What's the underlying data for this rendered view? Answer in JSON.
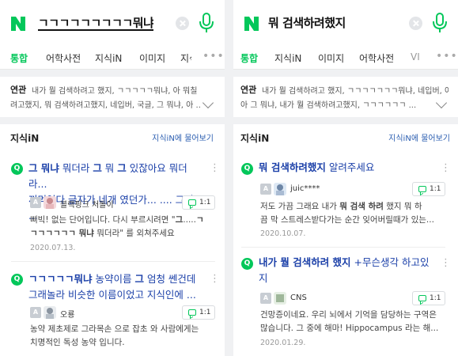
{
  "left": {
    "query": "ㄱㄱㄱㄱㄱㄱㄱㄱㄱ뭐냐",
    "tabs": [
      "통합",
      "어학사전",
      "지식iN",
      "이미지",
      "지식"
    ],
    "related_label": "연관",
    "related_lines": [
      "내가 뭘 검색하려고 했지, ㄱㄱㄱㄱㄱ뭐냐, 아 뭐칠",
      "려고했지, 뭐 검색하려고했지, 네입버, 국글, 그 뭐냐, 아 ..."
    ],
    "kin_title": "지식iN",
    "kin_link": "지식iN에 물어보기",
    "results": [
      {
        "title_lines": [
          "<b>그 뭐냐</b> 뭐더라 <b>그</b> 뭐 <b>그</b> 있잖아요 뭐더라...",
          "꺼먹었다 글자가 네개 였던가... .... 그거 ..."
        ],
        "author": "블랙핑크 처돌이",
        "reply": "1:1",
        "snippet": [
          "삐빅! 없는 단어입니다. 다시 부르시려면 \"<b>그</b>.....<b>ㄱ</b>",
          "<b>ㄱㄱㄱㄱㄱㄱ 뭐냐</b> 뭐더라\" 를 외쳐주세요"
        ],
        "date": "2020.07.13."
      },
      {
        "title_lines": [
          "<b>ㄱㄱㄱㄱㄱ뭐냐</b> 농약이름 <b>그</b> 엄청 쎈건데",
          "그래놀라 비슷한 이름이었고 지식인에 ..."
        ],
        "author": "오룡",
        "reply": "1:1",
        "snippet": [
          "농약 제초제로 그라목손 으로 잡초 와 사람에게는",
          "치명적인 독성 농약 입니다."
        ],
        "date": ""
      }
    ]
  },
  "right": {
    "query": "뭐 검색하려했지",
    "tabs": [
      "통합",
      "지식iN",
      "이미지",
      "어학사전",
      "VI"
    ],
    "related_label": "연관",
    "related_lines": [
      "내가 뭘 검색하려고 했지, ㄱㄱㄱㄱㄱㄱㄱ뭐냐, 네입버, 아 뭐",
      "아 그 뭐냐, 내가 뭘 검색하려고했지, ㄱㄱㄱㄱㄱㄱ ..."
    ],
    "kin_title": "지식iN",
    "kin_link": "지식iN에 물어보기",
    "results": [
      {
        "title_lines": [
          "<b>뭐 검색하려했지</b> 알려주세요"
        ],
        "author": "juic****",
        "reply": "1:1",
        "snippet": [
          "저도 가끔 그래요 내가 <b>뭐 검색 하려</b> 했지 뭐 하",
          "끔 막 스트레스받다가는 순간 잊어버릴때가 있는..."
        ],
        "date": "2020.10.07."
      },
      {
        "title_lines": [
          "<b>내가 뭘 검색하려 했지</b> +무슨생각 하고있",
          "지"
        ],
        "author": "CNS",
        "reply": "1:1",
        "snippet": [
          "건망증이네요. 우리 뇌에서 기억을 담당하는 구역은",
          "많습니다. 그 중에 해마! Hippocampus 라는 해..."
        ],
        "date": "2020.01.29."
      }
    ]
  },
  "colors": {
    "brand": "#03c75a",
    "link": "#1a3fa8",
    "gray": "#f0f1f3"
  },
  "icons": [
    "naver-logo-icon",
    "clear-icon",
    "mic-icon",
    "question-icon",
    "more-icon",
    "chevron-down-icon",
    "reply-icon"
  ]
}
